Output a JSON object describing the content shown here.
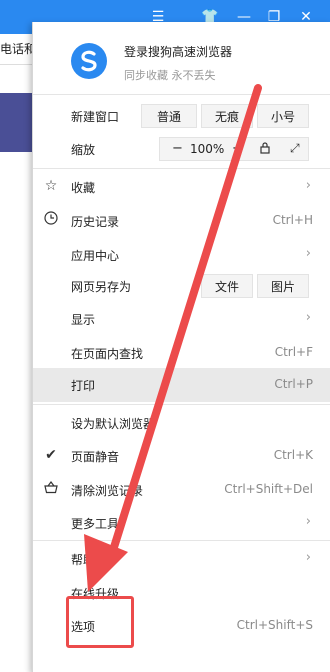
{
  "background": {
    "tab_text": "电话和",
    "titlebar_color": "#2a89f0",
    "banner_color": "#4a4f96"
  },
  "titlebar_icons": [
    "menu-icon",
    "skin-icon",
    "minimize-icon",
    "restore-icon",
    "close-icon"
  ],
  "menu": {
    "login_title": "登录搜狗高速浏览器",
    "login_subtitle": "同步收藏 永不丢失",
    "new_window": {
      "label": "新建窗口",
      "buttons": [
        "普通",
        "无痕",
        "小号"
      ]
    },
    "zoom": {
      "label": "缩放",
      "minus": "−",
      "value": "100%",
      "plus": "+"
    },
    "items": [
      {
        "label": "收藏",
        "icon": "star-icon",
        "submenu": true
      },
      {
        "label": "历史记录",
        "icon": "clock-icon",
        "shortcut": "Ctrl+H"
      },
      {
        "label": "应用中心",
        "submenu": true
      }
    ],
    "save_as": {
      "label": "网页另存为",
      "buttons": [
        "文件",
        "图片"
      ]
    },
    "items2": [
      {
        "label": "显示",
        "submenu": true
      },
      {
        "label": "在页面内查找",
        "shortcut": "Ctrl+F"
      },
      {
        "label": "打印",
        "shortcut": "Ctrl+P"
      }
    ],
    "items3": [
      {
        "label": "设为默认浏览器"
      },
      {
        "label": "页面静音",
        "icon": "check-icon",
        "shortcut": "Ctrl+K"
      },
      {
        "label": "清除浏览记录",
        "icon": "basket-icon",
        "shortcut": "Ctrl+Shift+Del"
      },
      {
        "label": "更多工具",
        "submenu": true
      }
    ],
    "items4": [
      {
        "label": "帮助",
        "submenu": true
      },
      {
        "label": "在线升级"
      },
      {
        "label": "选项",
        "shortcut": "Ctrl+Shift+S"
      }
    ]
  },
  "annotation_color": "#ec4b4b"
}
